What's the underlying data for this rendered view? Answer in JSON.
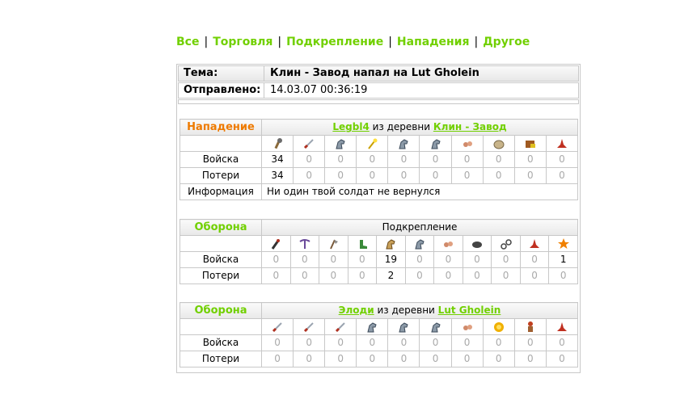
{
  "nav": {
    "items": [
      "Все",
      "Торговля",
      "Подкрепление",
      "Нападения",
      "Другое"
    ],
    "separator": "|"
  },
  "report": {
    "subject_label": "Тема:",
    "subject": "Клин - Завод напал на Lut Gholein",
    "sent_label": "Отправлено:",
    "sent": "14.03.07 00:36:19"
  },
  "attack": {
    "title": "Нападение",
    "player": "Legbl4",
    "from_text": "из деревни",
    "village": "Клин - Завод",
    "units": [
      "club-icon",
      "sword-icon",
      "horse-icon",
      "wand-icon",
      "horse-icon",
      "horse-icon",
      "beetle-icon",
      "hedgehog-icon",
      "catapult-icon",
      "hat-icon"
    ],
    "troops_label": "Войска",
    "troops": [
      "34",
      "0",
      "0",
      "0",
      "0",
      "0",
      "0",
      "0",
      "0",
      "0"
    ],
    "losses_label": "Потери",
    "losses": [
      "34",
      "0",
      "0",
      "0",
      "0",
      "0",
      "0",
      "0",
      "0",
      "0"
    ],
    "info_label": "Информация",
    "info": "Ни один твой солдат не вернулся"
  },
  "defense1": {
    "title": "Оборона",
    "subtitle": "Подкрепление",
    "units": [
      "torch-icon",
      "pickaxe-icon",
      "axe-icon",
      "boot-icon",
      "camel-icon",
      "horse-icon",
      "beetle-icon",
      "rock-icon",
      "cart-icon",
      "hat-icon",
      "star-icon"
    ],
    "troops_label": "Войска",
    "troops": [
      "0",
      "0",
      "0",
      "0",
      "19",
      "0",
      "0",
      "0",
      "0",
      "0",
      "1"
    ],
    "losses_label": "Потери",
    "losses": [
      "0",
      "0",
      "0",
      "0",
      "2",
      "0",
      "0",
      "0",
      "0",
      "0",
      "0"
    ]
  },
  "defense2": {
    "title": "Оборона",
    "player": "Элоди",
    "from_text": "из деревни",
    "village": "Lut Gholein",
    "units": [
      "sword-icon",
      "sword-icon",
      "sword-icon",
      "horse-icon",
      "horse-icon",
      "horse-icon",
      "beetle-icon",
      "sun-icon",
      "man-icon",
      "hat-icon"
    ],
    "troops_label": "Войска",
    "troops": [
      "0",
      "0",
      "0",
      "0",
      "0",
      "0",
      "0",
      "0",
      "0",
      "0"
    ],
    "losses_label": "Потери",
    "losses": [
      "0",
      "0",
      "0",
      "0",
      "0",
      "0",
      "0",
      "0",
      "0",
      "0"
    ]
  }
}
